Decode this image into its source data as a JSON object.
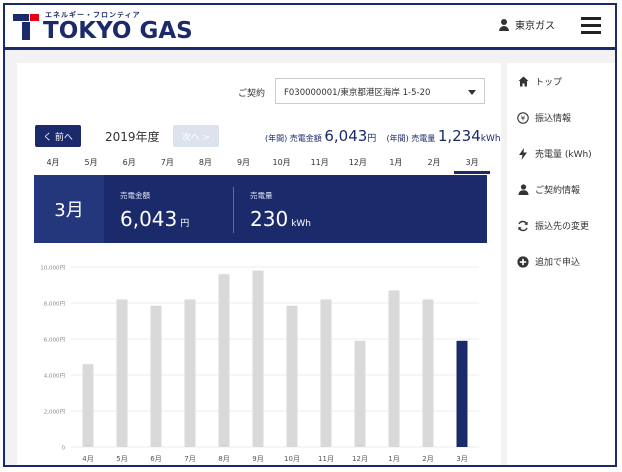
{
  "header": {
    "logo_kana": "エネルギー・フロンティア",
    "logo_text": "TOKYO GAS",
    "user_name": "東京ガス",
    "colors": {
      "brand_navy": "#1b2a6b",
      "brand_red": "#e60012"
    }
  },
  "contract": {
    "label": "ご契約",
    "selected": "F030000001/東京都港区海岸 1-5-20"
  },
  "navigation": {
    "prev_label": "く 前へ",
    "year": "2019年度",
    "next_label": "次へ >"
  },
  "annual": {
    "amount_label": "(年間) 売電金額",
    "amount_value": "6,043",
    "amount_unit": "円",
    "volume_label": "(年間) 売電量",
    "volume_value": "1,234",
    "volume_unit": "kWh"
  },
  "months": [
    "4月",
    "5月",
    "6月",
    "7月",
    "8月",
    "9月",
    "10月",
    "11月",
    "12月",
    "1月",
    "2月",
    "3月"
  ],
  "selected_month_index": 11,
  "summary": {
    "month": "3月",
    "amount_label": "売電金額",
    "amount_value": "6,043",
    "amount_unit": "円",
    "volume_label": "売電量",
    "volume_value": "230",
    "volume_unit": "kWh"
  },
  "chart_data": {
    "type": "bar",
    "categories": [
      "4月",
      "5月",
      "6月",
      "7月",
      "8月",
      "9月",
      "10月",
      "11月",
      "12月",
      "1月",
      "2月",
      "3月"
    ],
    "values": [
      4600,
      8200,
      7850,
      8200,
      9600,
      9800,
      7850,
      8200,
      5900,
      8700,
      8200,
      5900
    ],
    "ylim": [
      0,
      10000
    ],
    "yticks": [
      "0",
      "2,000円",
      "4,000円",
      "6,000円",
      "8,000円",
      "10,000円"
    ],
    "highlight_index": 11,
    "colors": {
      "bar": "#d9d9d9",
      "highlight": "#1b2a6b"
    },
    "grid": true
  },
  "sidebar": {
    "items": [
      {
        "label": "トップ",
        "icon": "home-icon"
      },
      {
        "label": "振込情報",
        "icon": "yen-icon"
      },
      {
        "label": "売電量 (kWh)",
        "icon": "lightning-icon"
      },
      {
        "label": "ご契約情報",
        "icon": "person-icon"
      },
      {
        "label": "振込先の変更",
        "icon": "refresh-icon"
      },
      {
        "label": "追加で申込",
        "icon": "plus-circle-icon"
      }
    ]
  }
}
